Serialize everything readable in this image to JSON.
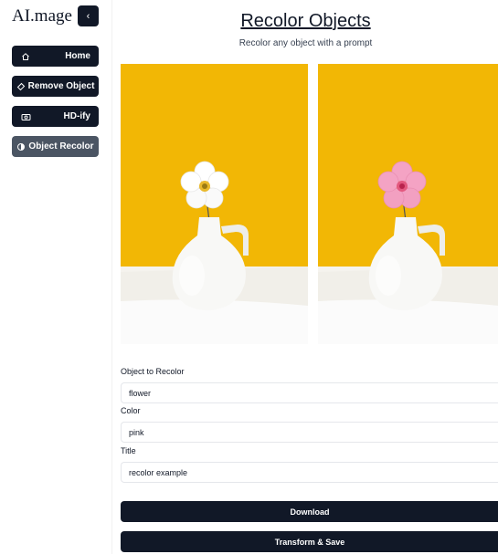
{
  "app": {
    "logo": "AI.mage"
  },
  "sidebar": {
    "items": [
      {
        "label": "Home",
        "icon": "home-icon",
        "active": false
      },
      {
        "label": "Remove Object",
        "icon": "eraser-icon",
        "active": false
      },
      {
        "label": "HD-ify",
        "icon": "camera-icon",
        "active": false
      },
      {
        "label": "Object Recolor",
        "icon": "contrast-icon",
        "active": true
      }
    ]
  },
  "main": {
    "title": "Recolor Objects",
    "subtitle": "Recolor any object with a prompt",
    "images": {
      "original_flower_color": "#ffffff",
      "recolored_flower_color": "#f4a3c4",
      "background_color": "#f2b705"
    },
    "form": {
      "object_label": "Object to Recolor",
      "object_value": "flower",
      "color_label": "Color",
      "color_value": "pink",
      "title_label": "Title",
      "title_value": "recolor example"
    },
    "buttons": {
      "download": "Download",
      "transform": "Transform & Save"
    }
  },
  "colors": {
    "button_dark": "#111827",
    "button_active": "#4b5563"
  }
}
